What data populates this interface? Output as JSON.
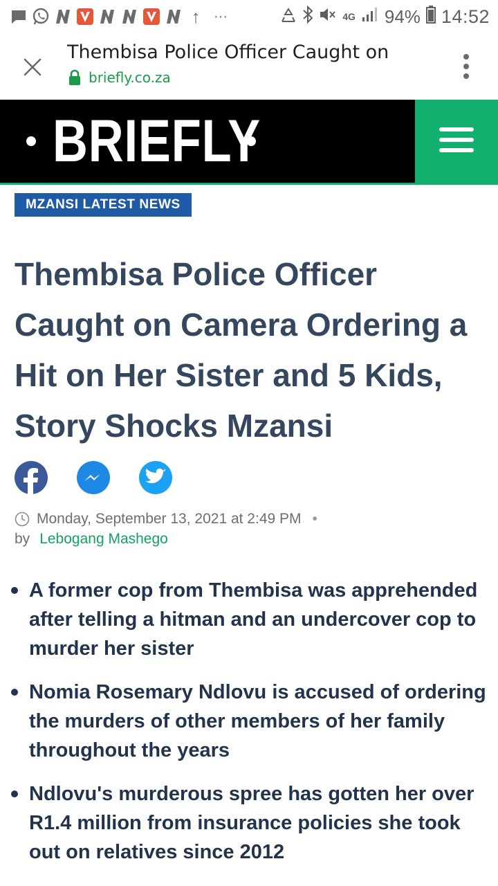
{
  "status_bar": {
    "battery": "94%",
    "time": "14:52",
    "network": "4G",
    "upload_indicator": "↑",
    "more_indicator": "···",
    "icons": [
      "message-icon",
      "whatsapp-icon",
      "n-app-icon",
      "v-app-icon",
      "n-app-icon",
      "n-app-icon",
      "v-app-icon",
      "n-app-icon",
      "upload-icon",
      "more-icon",
      "recycle-icon",
      "bluetooth-icon",
      "mute-icon",
      "network-4g-icon",
      "signal-icon",
      "battery-icon"
    ]
  },
  "browser": {
    "page_title": "Thembisa Police Officer Caught on",
    "url": "briefly.co.za",
    "icons": [
      "close-icon",
      "lock-icon",
      "kebab-menu-icon"
    ]
  },
  "site": {
    "logo": "BRIEFLY",
    "accent_color": "#12b06e",
    "menu_icon": "hamburger-icon"
  },
  "article": {
    "category": "MZANSI LATEST NEWS",
    "headline": "Thembisa Police Officer Caught on Camera Ordering a Hit on Her Sister and 5 Kids, Story Shocks Mzansi",
    "share": [
      "facebook-icon",
      "messenger-icon",
      "twitter-icon"
    ],
    "date": "Monday, September 13, 2021 at 2:49 PM",
    "separator": "•",
    "by_label": "by",
    "author": "Lebogang Mashego",
    "bullets": [
      "A former cop from Thembisa was apprehended after telling a hitman and an undercover cop to murder her sister",
      "Nomia Rosemary Ndlovu is accused of ordering the murders of other members of her family throughout the years",
      "Ndlovu's murderous spree has gotten her over R1.4 million from insurance policies she took out on relatives since 2012"
    ]
  }
}
